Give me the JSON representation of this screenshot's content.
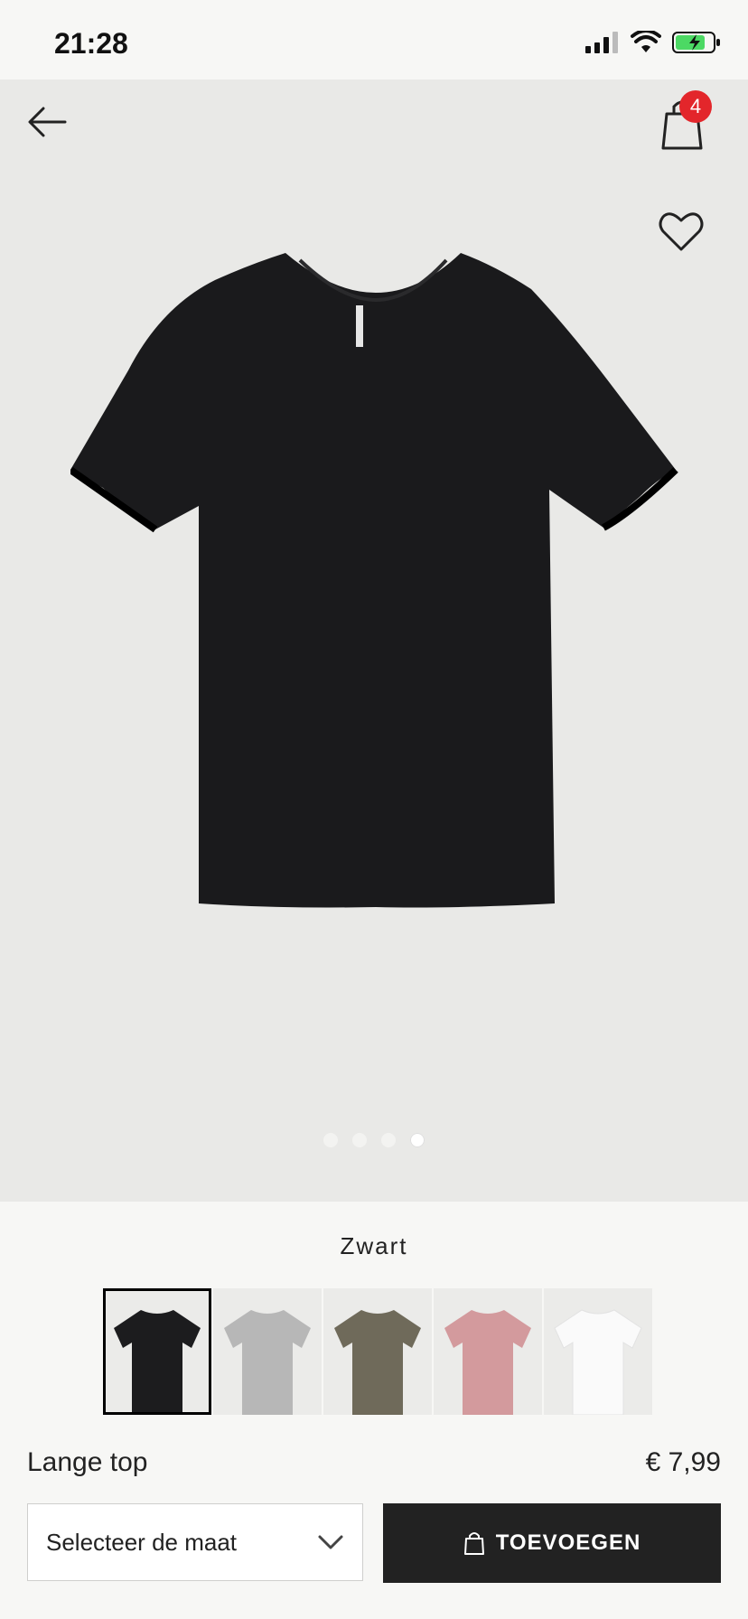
{
  "status_bar": {
    "time": "21:28"
  },
  "header": {
    "cart_count": "4"
  },
  "gallery": {
    "slides": [
      false,
      false,
      false,
      true
    ]
  },
  "color": {
    "selected_name": "Zwart",
    "swatches": [
      {
        "name": "black",
        "color": "#1c1c1e",
        "selected": true
      },
      {
        "name": "grey",
        "color": "#b7b7b7",
        "selected": false
      },
      {
        "name": "khaki",
        "color": "#6f6a5a",
        "selected": false
      },
      {
        "name": "pink",
        "color": "#d39a9d",
        "selected": false
      },
      {
        "name": "white",
        "color": "#f8f8f8",
        "selected": false
      }
    ]
  },
  "product": {
    "name": "Lange top",
    "price": "€ 7,99",
    "size_placeholder": "Selecteer de maat",
    "add_label": "TOEVOEGEN"
  },
  "colors": {
    "badge": "#e3262b",
    "button": "#222222",
    "battery": "#4cd964"
  }
}
